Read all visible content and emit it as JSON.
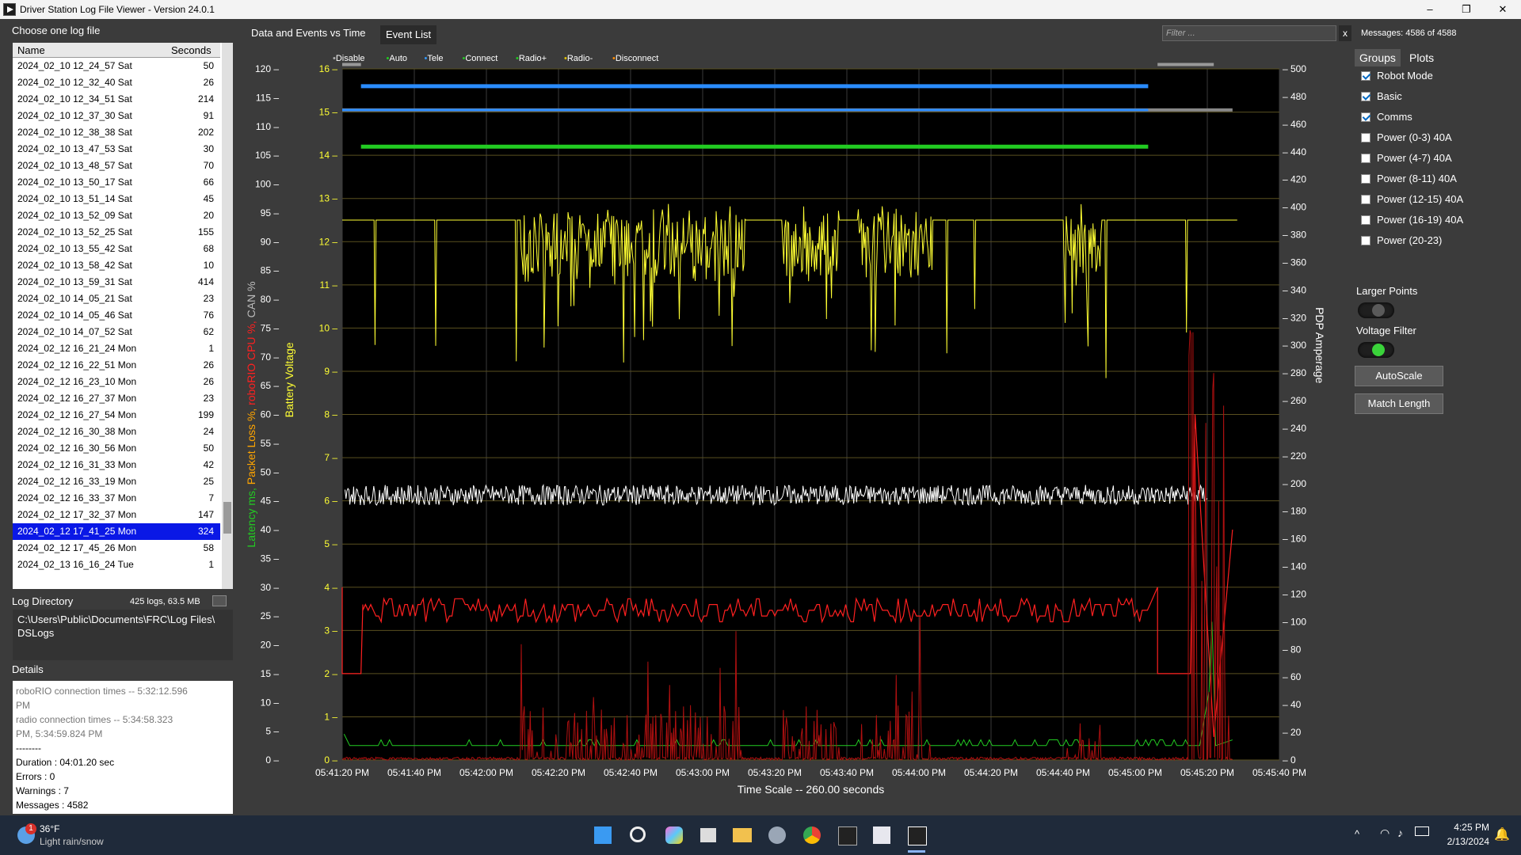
{
  "title": "Driver Station Log File Viewer - Version 24.0.1",
  "window_controls": {
    "minimize": "–",
    "maximize": "❐",
    "close": "✕"
  },
  "left": {
    "choose_label": "Choose one log file",
    "col_name": "Name",
    "col_seconds": "Seconds",
    "logs": [
      {
        "name": "2024_02_10 12_24_57 Sat",
        "seconds": "50"
      },
      {
        "name": "2024_02_10 12_32_40 Sat",
        "seconds": "26"
      },
      {
        "name": "2024_02_10 12_34_51 Sat",
        "seconds": "214"
      },
      {
        "name": "2024_02_10 12_37_30 Sat",
        "seconds": "91"
      },
      {
        "name": "2024_02_10 12_38_38 Sat",
        "seconds": "202"
      },
      {
        "name": "2024_02_10 13_47_53 Sat",
        "seconds": "30"
      },
      {
        "name": "2024_02_10 13_48_57 Sat",
        "seconds": "70"
      },
      {
        "name": "2024_02_10 13_50_17 Sat",
        "seconds": "66"
      },
      {
        "name": "2024_02_10 13_51_14 Sat",
        "seconds": "45"
      },
      {
        "name": "2024_02_10 13_52_09 Sat",
        "seconds": "20"
      },
      {
        "name": "2024_02_10 13_52_25 Sat",
        "seconds": "155"
      },
      {
        "name": "2024_02_10 13_55_42 Sat",
        "seconds": "68"
      },
      {
        "name": "2024_02_10 13_58_42 Sat",
        "seconds": "10"
      },
      {
        "name": "2024_02_10 13_59_31 Sat",
        "seconds": "414"
      },
      {
        "name": "2024_02_10 14_05_21 Sat",
        "seconds": "23"
      },
      {
        "name": "2024_02_10 14_05_46 Sat",
        "seconds": "76"
      },
      {
        "name": "2024_02_10 14_07_52 Sat",
        "seconds": "62"
      },
      {
        "name": "2024_02_12 16_21_24 Mon",
        "seconds": "1"
      },
      {
        "name": "2024_02_12 16_22_51 Mon",
        "seconds": "26"
      },
      {
        "name": "2024_02_12 16_23_10 Mon",
        "seconds": "26"
      },
      {
        "name": "2024_02_12 16_27_37 Mon",
        "seconds": "23"
      },
      {
        "name": "2024_02_12 16_27_54 Mon",
        "seconds": "199"
      },
      {
        "name": "2024_02_12 16_30_38 Mon",
        "seconds": "24"
      },
      {
        "name": "2024_02_12 16_30_56 Mon",
        "seconds": "50"
      },
      {
        "name": "2024_02_12 16_31_33 Mon",
        "seconds": "42"
      },
      {
        "name": "2024_02_12 16_33_19 Mon",
        "seconds": "25"
      },
      {
        "name": "2024_02_12 16_33_37 Mon",
        "seconds": "7"
      },
      {
        "name": "2024_02_12 17_32_37 Mon",
        "seconds": "147"
      },
      {
        "name": "2024_02_12 17_41_25 Mon",
        "seconds": "324"
      },
      {
        "name": "2024_02_12 17_45_26 Mon",
        "seconds": "58"
      },
      {
        "name": "2024_02_13 16_16_24 Tue",
        "seconds": "1"
      }
    ],
    "selected_index": 28,
    "log_dir_label": "Log Directory",
    "log_dir_info": "425 logs, 63.5 MB",
    "log_dir_path_1": "C:\\Users\\Public\\Documents\\FRC\\Log Files\\",
    "log_dir_path_2": "DSLogs",
    "details_label": "Details",
    "details": {
      "line1": "roboRIO connection times --  5:32:12.596",
      "line2": "PM",
      "line3": "radio connection times --  5:34:58.323",
      "line4": "PM,  5:34:59.824 PM",
      "line5": "--------",
      "duration": "Duration : 04:01.20 sec",
      "errors": "Errors : 0",
      "warnings": "Warnings : 7",
      "messages": "Messages : 4582"
    }
  },
  "tabs": {
    "data_events": "Data and Events vs Time",
    "event_list": "Event List"
  },
  "filter_placeholder": "Filter ...",
  "filter_clear": "x",
  "messages_count": "Messages: 4586 of 4588",
  "right": {
    "tab_groups": "Groups",
    "tab_plots": "Plots",
    "groups": [
      {
        "label": "Robot Mode",
        "checked": true
      },
      {
        "label": "Basic",
        "checked": true
      },
      {
        "label": "Comms",
        "checked": true
      },
      {
        "label": "Power (0-3) 40A",
        "checked": false
      },
      {
        "label": "Power (4-7) 40A",
        "checked": false
      },
      {
        "label": "Power (8-11) 40A",
        "checked": false
      },
      {
        "label": "Power (12-15) 40A",
        "checked": false
      },
      {
        "label": "Power (16-19) 40A",
        "checked": false
      },
      {
        "label": "Power (20-23)",
        "checked": false
      }
    ],
    "larger_points": "Larger Points",
    "larger_points_on": false,
    "voltage_filter": "Voltage Filter",
    "voltage_filter_on": true,
    "autoscale": "AutoScale",
    "match_length": "Match Length"
  },
  "chart_data": {
    "type": "line",
    "legend": [
      {
        "label": "Disable",
        "color": "#b0b0b0"
      },
      {
        "label": "Auto",
        "color": "#22cc22"
      },
      {
        "label": "Tele",
        "color": "#3399ff"
      },
      {
        "label": "Connect",
        "color": "#22cc22"
      },
      {
        "label": "Radio+",
        "color": "#22cc22"
      },
      {
        "label": "Radio-",
        "color": "#e0c000"
      },
      {
        "label": "Disconnect",
        "color": "#ff8c00"
      }
    ],
    "left_axis_outer": {
      "label": "Latency ms, Packet Loss %, roboRIO CPU %, CAN %",
      "range": [
        0,
        120
      ],
      "ticks": [
        "120",
        "115",
        "110",
        "105",
        "100",
        "95",
        "90",
        "85",
        "80",
        "75",
        "70",
        "65",
        "60",
        "55",
        "50",
        "45",
        "40",
        "35",
        "30",
        "25",
        "20",
        "15",
        "10",
        "5",
        "0"
      ]
    },
    "left_axis_inner": {
      "label": "Battery Voltage",
      "range": [
        0,
        16
      ],
      "ticks": [
        "16",
        "15",
        "14",
        "13",
        "12",
        "11",
        "10",
        "9",
        "8",
        "7",
        "6",
        "5",
        "4",
        "3",
        "2",
        "1",
        "0"
      ]
    },
    "right_axis": {
      "label": "PDP Amperage",
      "range": [
        0,
        500
      ],
      "ticks": [
        "500",
        "480",
        "460",
        "440",
        "420",
        "400",
        "380",
        "360",
        "340",
        "320",
        "300",
        "280",
        "260",
        "240",
        "220",
        "200",
        "180",
        "160",
        "140",
        "120",
        "100",
        "80",
        "60",
        "40",
        "20",
        "0"
      ]
    },
    "x_ticks": [
      "05:41:20 PM",
      "05:41:40 PM",
      "05:42:00 PM",
      "05:42:20 PM",
      "05:42:40 PM",
      "05:43:00 PM",
      "05:43:20 PM",
      "05:43:40 PM",
      "05:44:00 PM",
      "05:44:20 PM",
      "05:44:40 PM",
      "05:45:00 PM",
      "05:45:20 PM",
      "05:45:40 PM"
    ],
    "x_range_seconds": 260,
    "x_title": "Time Scale -- 260.00 seconds",
    "series": [
      {
        "name": "Battery Voltage",
        "axis": "voltage",
        "color": "#ffff33",
        "baseline": 12.5
      },
      {
        "name": "CAN %",
        "axis": "pct",
        "color": "#ffffff",
        "baseline": 46
      },
      {
        "name": "roboRIO CPU %",
        "axis": "pct",
        "color": "#ff2020",
        "baseline": 27
      },
      {
        "name": "Latency ms",
        "axis": "pct",
        "color": "#22cc22",
        "baseline": 3
      },
      {
        "name": "PDP Amperage",
        "axis": "amps",
        "color": "#cc1010",
        "baseline": 0
      }
    ]
  },
  "taskbar": {
    "weather_temp": "36°F",
    "weather_desc": "Light rain/snow",
    "weather_badge": "1",
    "time": "4:25 PM",
    "date": "2/13/2024"
  }
}
